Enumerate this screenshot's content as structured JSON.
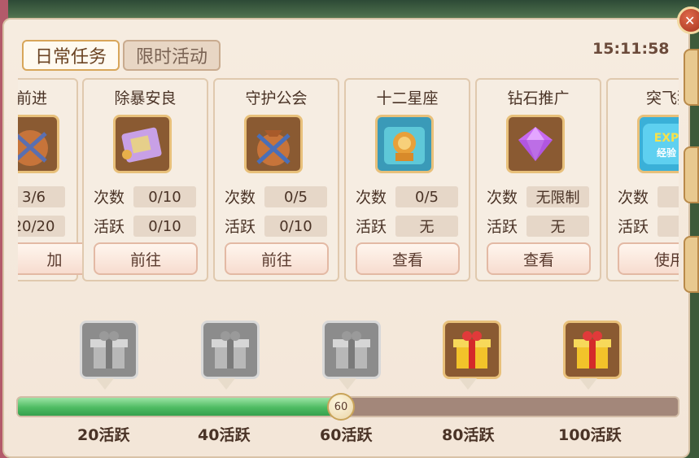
{
  "header": {
    "tabs": [
      {
        "label": "日常任务",
        "active": true
      },
      {
        "label": "限时活动",
        "active": false
      }
    ],
    "clock": "15:11:58"
  },
  "tasks": [
    {
      "title": "前进",
      "icon": "coin-bag-icon",
      "count_label": "",
      "count": "3/6",
      "active_label": "",
      "active": "20/20",
      "button": "加"
    },
    {
      "title": "除暴安良",
      "icon": "scroll-icon",
      "count_label": "次数",
      "count": "0/10",
      "active_label": "活跃",
      "active": "0/10",
      "button": "前往"
    },
    {
      "title": "守护公会",
      "icon": "guild-bag-icon",
      "count_label": "次数",
      "count": "0/5",
      "active_label": "活跃",
      "active": "0/10",
      "button": "前往"
    },
    {
      "title": "十二星座",
      "icon": "zodiac-lion-icon",
      "count_label": "次数",
      "count": "0/5",
      "active_label": "活跃",
      "active": "无",
      "button": "查看"
    },
    {
      "title": "钻石推广",
      "icon": "diamond-icon",
      "count_label": "次数",
      "count": "无限制",
      "active_label": "活跃",
      "active": "无",
      "button": "查看"
    },
    {
      "title": "突飞猛",
      "icon": "exp-icon",
      "icon_text_1": "EXP",
      "icon_text_2": "经验",
      "count_label": "次数",
      "count": "",
      "active_label": "活跃",
      "active": "",
      "button": "使用"
    }
  ],
  "rewards": {
    "current": 60,
    "max": 100,
    "knob_label": "60",
    "milestones": [
      {
        "label": "20活跃",
        "state": "claimed"
      },
      {
        "label": "40活跃",
        "state": "claimed"
      },
      {
        "label": "60活跃",
        "state": "claimed"
      },
      {
        "label": "80活跃",
        "state": "available"
      },
      {
        "label": "100活跃",
        "state": "available"
      }
    ]
  },
  "close": {
    "glyph": "✕"
  },
  "colors": {
    "progress": "#4dbb62",
    "panel": "#f3e6d8",
    "gold": "#e8c07a"
  }
}
